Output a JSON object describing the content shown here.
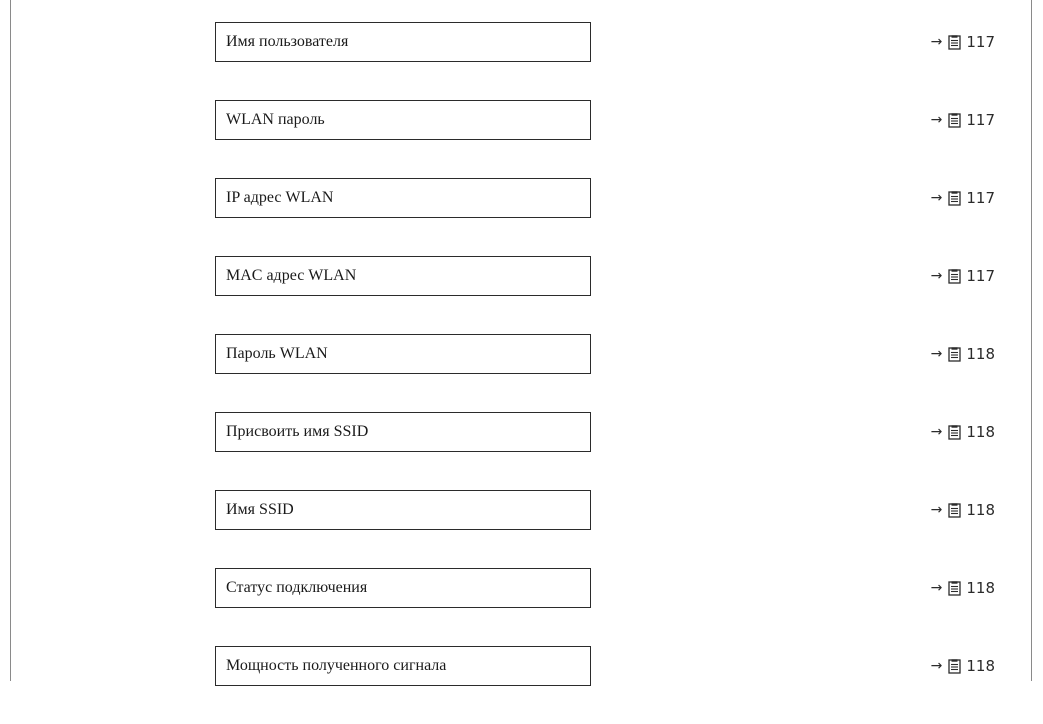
{
  "parameters": [
    {
      "label": "Имя пользователя",
      "page": "117"
    },
    {
      "label": "WLAN пароль",
      "page": "117"
    },
    {
      "label": "IP адрес WLAN",
      "page": "117"
    },
    {
      "label": "MAC адрес WLAN",
      "page": "117"
    },
    {
      "label": "Пароль WLAN",
      "page": "118"
    },
    {
      "label": "Присвоить имя SSID",
      "page": "118"
    },
    {
      "label": "Имя SSID",
      "page": "118"
    },
    {
      "label": "Статус подключения",
      "page": "118"
    },
    {
      "label": "Мощность полученного сигнала",
      "page": "118"
    }
  ],
  "ref": {
    "arrow_icon": "→",
    "page_icon": "page-reference-icon"
  }
}
